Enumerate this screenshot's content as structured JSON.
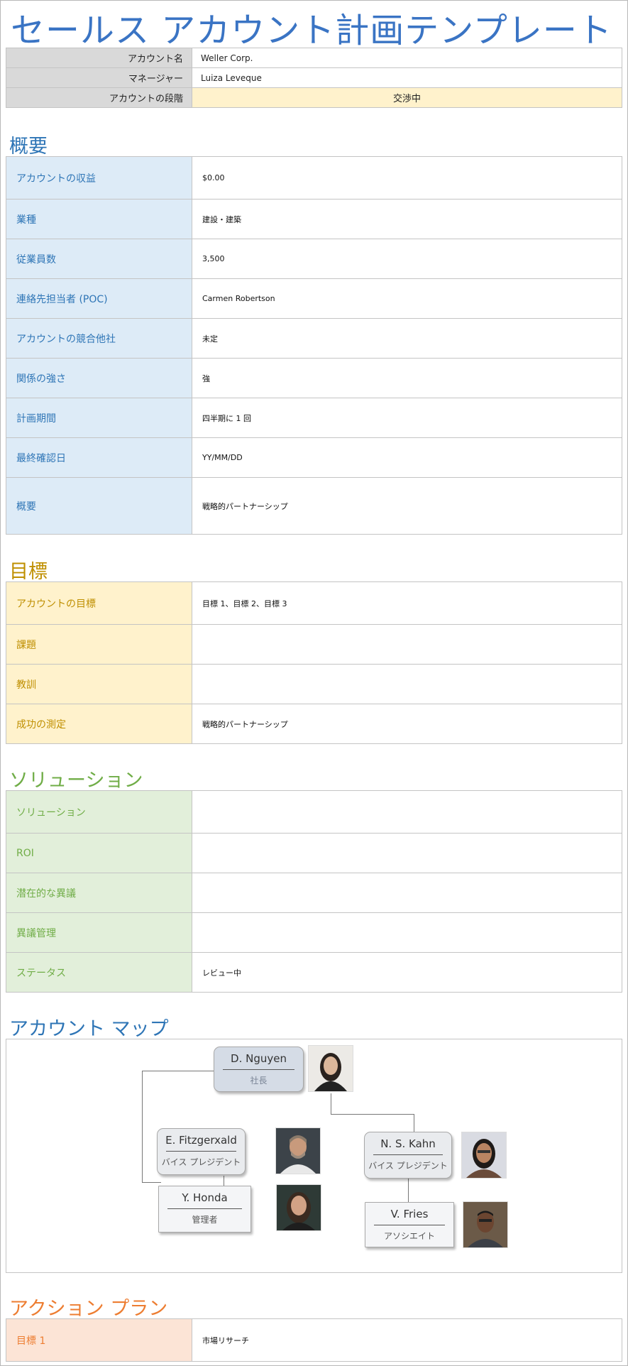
{
  "title": "セールス アカウント計画テンプレート",
  "account": {
    "name_label": "アカウント名",
    "name_value": "Weller Corp.",
    "manager_label": "マネージャー",
    "manager_value": "Luiza Leveque",
    "stage_label": "アカウントの段階",
    "stage_value": "交渉中"
  },
  "overview": {
    "title": "概要",
    "rows": [
      {
        "label": "アカウントの収益",
        "value": "$0.00"
      },
      {
        "label": "業種",
        "value": "建設・建築"
      },
      {
        "label": "従業員数",
        "value": "3,500"
      },
      {
        "label": "連絡先担当者 (POC)",
        "value": "Carmen Robertson"
      },
      {
        "label": "アカウントの競合他社",
        "value": "未定"
      },
      {
        "label": "関係の強さ",
        "value": "強"
      },
      {
        "label": "計画期間",
        "value": "四半期に 1 回"
      },
      {
        "label": "最終確認日",
        "value": "YY/MM/DD"
      },
      {
        "label": "概要",
        "value": "戦略的パートナーシップ"
      }
    ]
  },
  "goals": {
    "title": "目標",
    "rows": [
      {
        "label": "アカウントの目標",
        "value": "目標 1、目標 2、目標 3"
      },
      {
        "label": "課題",
        "value": ""
      },
      {
        "label": "教訓",
        "value": ""
      },
      {
        "label": "成功の測定",
        "value": "戦略的パートナーシップ"
      }
    ]
  },
  "solutions": {
    "title": "ソリューション",
    "rows": [
      {
        "label": "ソリューション",
        "value": ""
      },
      {
        "label": "ROI",
        "value": ""
      },
      {
        "label": "潜在的な異議",
        "value": ""
      },
      {
        "label": "異議管理",
        "value": ""
      },
      {
        "label": "ステータス",
        "value": "レビュー中"
      }
    ]
  },
  "account_map": {
    "title": "アカウント マップ",
    "people": [
      {
        "name": "D. Nguyen",
        "role": "社長"
      },
      {
        "name": "E. Fitzgerxald",
        "role": "バイス プレジデント"
      },
      {
        "name": "N. S. Kahn",
        "role": "バイス プレジデント"
      },
      {
        "name": "Y. Honda",
        "role": "管理者"
      },
      {
        "name": "V. Fries",
        "role": "アソシエイト"
      }
    ]
  },
  "action_plan": {
    "title": "アクション プラン",
    "rows": [
      {
        "label": "目標 1",
        "value": "市場リサーチ"
      }
    ]
  },
  "colors": {
    "title": "#3a74c4",
    "overview_accent": "#2e75b6",
    "goals_accent": "#bf8f00",
    "solutions_accent": "#70ad47",
    "action_accent": "#ed7d31",
    "stage_fill": "#fff2cc"
  }
}
